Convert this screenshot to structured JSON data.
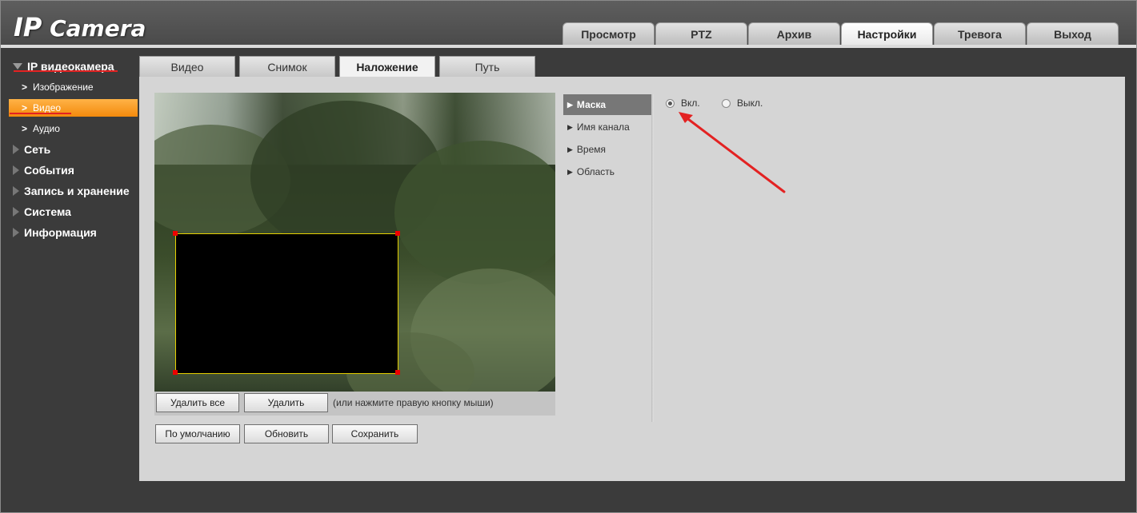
{
  "app": {
    "logo_ip": "IP",
    "logo_camera": "Camera"
  },
  "topnav": [
    {
      "label": "Просмотр",
      "active": false
    },
    {
      "label": "PTZ",
      "active": false
    },
    {
      "label": "Архив",
      "active": false
    },
    {
      "label": "Настройки",
      "active": true
    },
    {
      "label": "Тревога",
      "active": false
    },
    {
      "label": "Выход",
      "active": false
    }
  ],
  "sidebar": {
    "camera": "IP видеокамера",
    "sub_image": "Изображение",
    "sub_video": "Видео",
    "sub_audio": "Аудио",
    "network": "Сеть",
    "events": "События",
    "storage": "Запись и хранение",
    "system": "Система",
    "info": "Информация"
  },
  "subtabs": [
    {
      "label": "Видео",
      "active": false
    },
    {
      "label": "Снимок",
      "active": false
    },
    {
      "label": "Наложение",
      "active": true
    },
    {
      "label": "Путь",
      "active": false
    }
  ],
  "video_controls": {
    "delete_all": "Удалить все",
    "delete": "Удалить",
    "hint": "(или нажмите правую кнопку мыши)"
  },
  "actions": {
    "default": "По умолчанию",
    "refresh": "Обновить",
    "save": "Сохранить"
  },
  "submenu": [
    {
      "label": "Маска",
      "active": true
    },
    {
      "label": "Имя канала",
      "active": false
    },
    {
      "label": "Время",
      "active": false
    },
    {
      "label": "Область",
      "active": false
    }
  ],
  "mask": {
    "on_label": "Вкл.",
    "off_label": "Выкл.",
    "selected": "on"
  },
  "colors": {
    "accent_orange": "#f38a0c",
    "annotation_red": "#e32222",
    "mask_border": "#e6d000"
  }
}
